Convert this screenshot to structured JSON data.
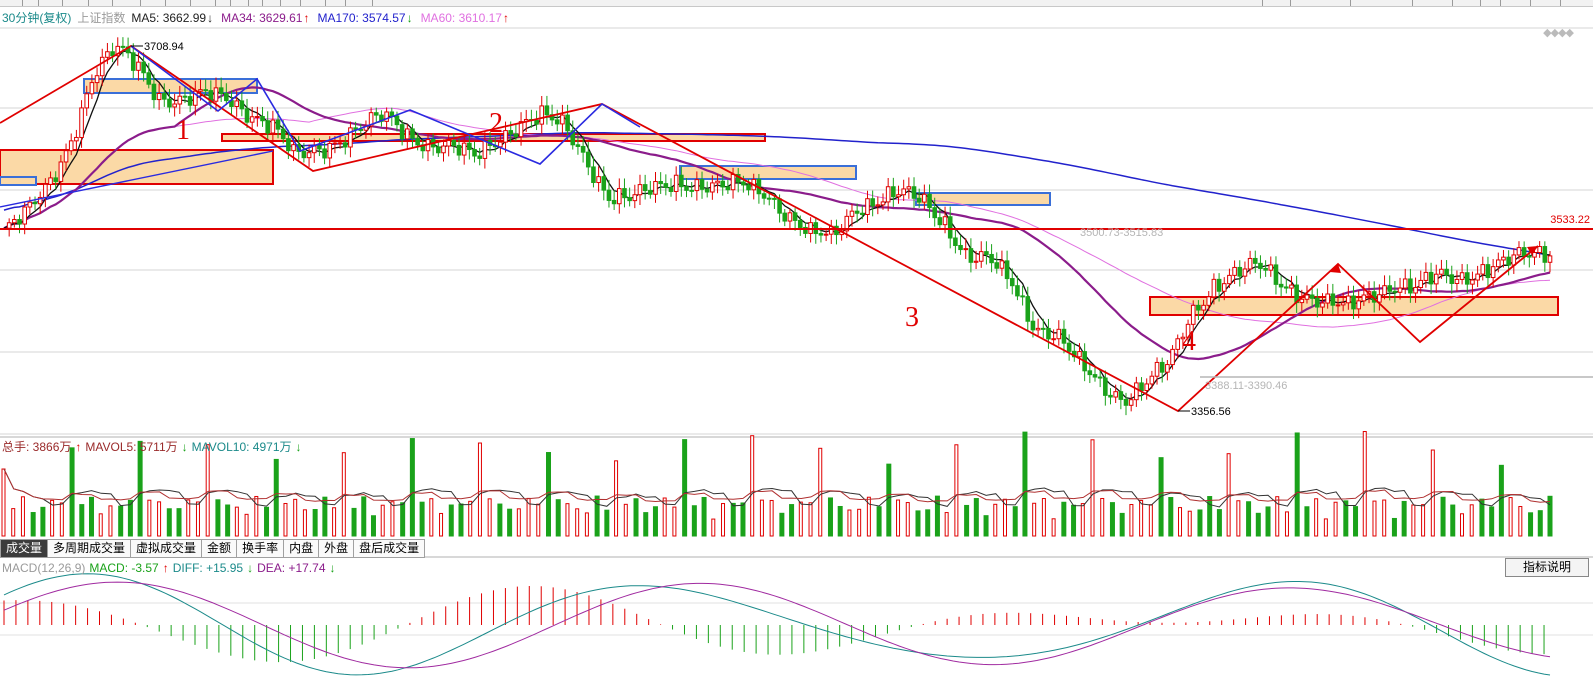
{
  "legend": {
    "period": "30分钟(复权)",
    "index_name": "上证指数",
    "ma5_label": "MA5: 3662.99",
    "ma5_arrow": "↓",
    "ma34_label": "MA34: 3629.61",
    "ma34_arrow": "↑",
    "ma170_label": "MA170: 3574.57",
    "ma170_arrow": "↓",
    "ma60_label": "MA60: 3610.17",
    "ma60_arrow": "↑"
  },
  "price_labels": {
    "high": "3708.94",
    "low": "3356.56",
    "level_right": "3533.22",
    "range_mid": "3500.73-3515.83",
    "range_low": "3388.11-3390.46"
  },
  "annotations": [
    "1",
    "2",
    "3",
    "4"
  ],
  "volume_legend": {
    "total": "总手: 3866万",
    "total_arrow": "↑",
    "mavol5": "MAVOL5: 5711万",
    "mavol5_arrow": "↓",
    "mavol10": "MAVOL10: 4971万",
    "mavol10_arrow": "↓"
  },
  "tabs": [
    {
      "label": "成交量",
      "active": true
    },
    {
      "label": "多周期成交量",
      "active": false
    },
    {
      "label": "虚拟成交量",
      "active": false
    },
    {
      "label": "金额",
      "active": false
    },
    {
      "label": "换手率",
      "active": false
    },
    {
      "label": "内盘",
      "active": false
    },
    {
      "label": "外盘",
      "active": false
    },
    {
      "label": "盘后成交量",
      "active": false
    }
  ],
  "macd_legend": {
    "name": "MACD(12,26,9)",
    "macd": "MACD: -3.57",
    "macd_arrow": "↑",
    "diff": "DIFF: +15.95",
    "diff_arrow": "↓",
    "dea": "DEA: +17.74",
    "dea_arrow": "↓"
  },
  "explain_button": "指标说明",
  "colors": {
    "up": "#e00000",
    "down": "#1aa21a",
    "ma5": "#111111",
    "ma34": "#8b1c8b",
    "ma170": "#2222cc",
    "ma60": "#e070e0",
    "annotation": "#e00000",
    "box_fill": "#fbd9a6"
  },
  "chart_data": {
    "type": "candlestick",
    "title": "",
    "instrument": "上证指数",
    "period": "30分钟(复权)",
    "ylim": [
      3340,
      3730
    ],
    "high_point": 3708.94,
    "low_point": 3356.56,
    "levels": [
      3533.22
    ],
    "ranges": [
      [
        3500.73,
        3515.83
      ],
      [
        3388.11,
        3390.46
      ]
    ],
    "close_path": [
      3530,
      3545,
      3575,
      3620,
      3680,
      3705,
      3690,
      3660,
      3655,
      3660,
      3660,
      3645,
      3630,
      3600,
      3610,
      3620,
      3630,
      3640,
      3625,
      3615,
      3610,
      3600,
      3620,
      3635,
      3640,
      3630,
      3600,
      3565,
      3560,
      3570,
      3580,
      3575,
      3570,
      3575,
      3570,
      3545,
      3525,
      3525,
      3555,
      3560,
      3565,
      3560,
      3540,
      3505,
      3500,
      3480,
      3440,
      3430,
      3400,
      3380,
      3370,
      3385,
      3400,
      3450,
      3480,
      3490,
      3495,
      3480,
      3470,
      3460,
      3455,
      3470,
      3480,
      3475,
      3485,
      3485,
      3495,
      3500,
      3505,
      3510
    ],
    "mavol_unit": "万",
    "total_volume": 3866,
    "mavol5": 5711,
    "mavol10": 4971,
    "macd": -3.57,
    "diff": 15.95,
    "dea": 17.74
  }
}
